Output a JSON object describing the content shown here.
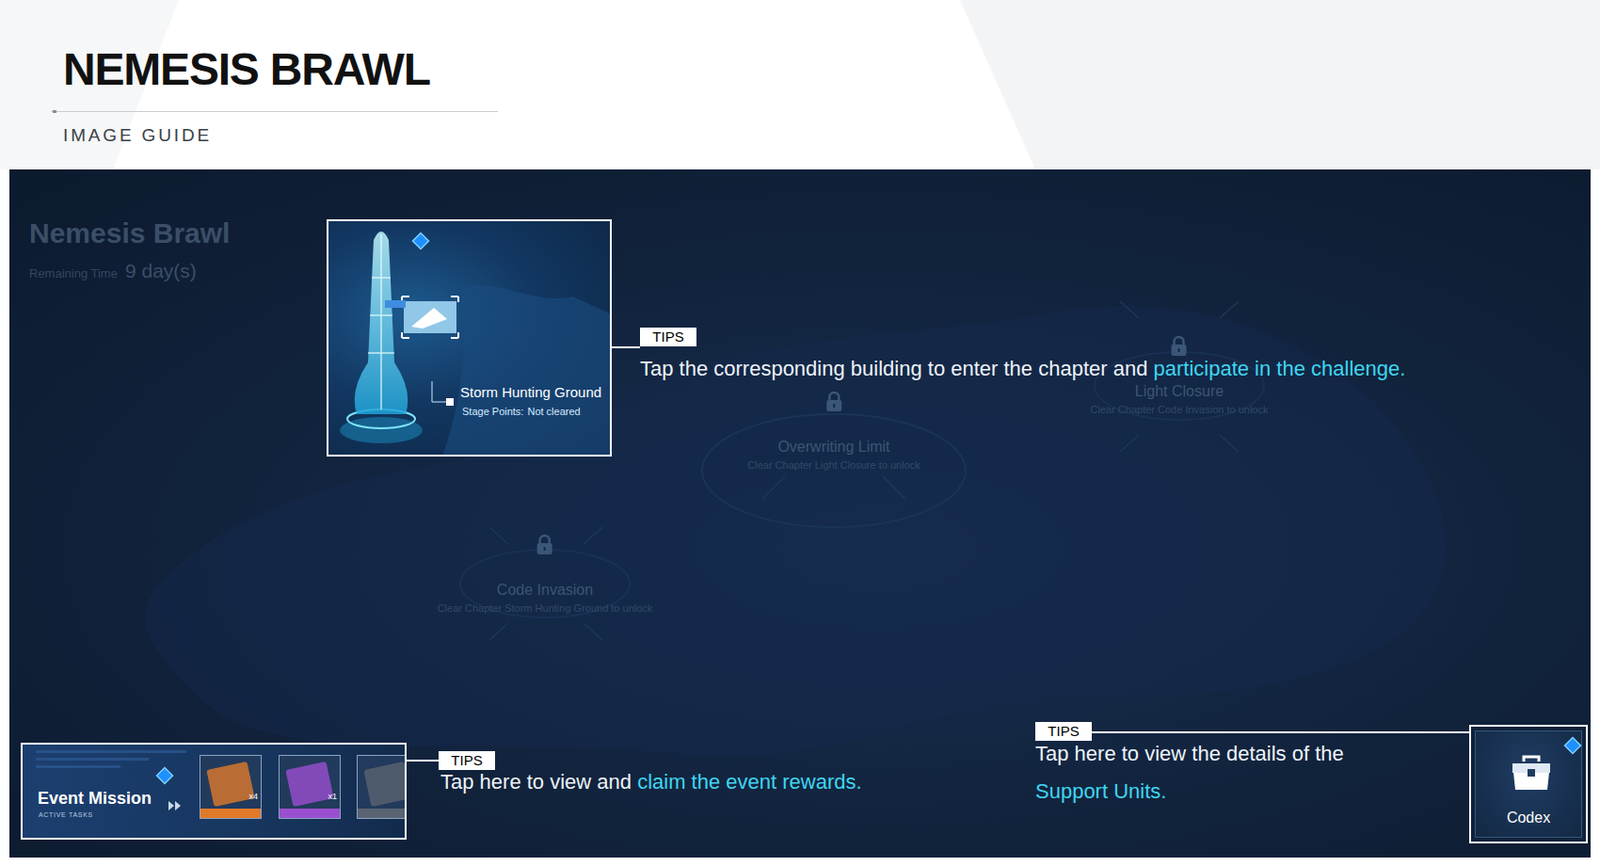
{
  "header": {
    "title": "NEMESIS BRAWL",
    "subtitle": "IMAGE GUIDE"
  },
  "event": {
    "title": "Nemesis Brawl",
    "remaining_label": "Remaining Time",
    "remaining_value": "9 day(s)"
  },
  "chapters": [
    {
      "kind": "open",
      "name": "Storm Hunting Ground",
      "points_label": "Stage Points:",
      "points_value": "Not cleared",
      "locked": false
    },
    {
      "kind": "locked",
      "name": "Code Invasion",
      "unlock_hint": "Clear Chapter Storm Hunting Ground to unlock",
      "locked": true
    },
    {
      "kind": "locked",
      "name": "Overwriting Limit",
      "unlock_hint": "Clear Chapter Light Closure to unlock",
      "locked": true
    },
    {
      "kind": "locked",
      "name": "Light Closure",
      "unlock_hint": "Clear Chapter Code Invasion to unlock",
      "locked": true
    }
  ],
  "tips": [
    {
      "label": "TIPS",
      "text": "Tap the corresponding building to enter the chapter and ",
      "highlight": "participate in the challenge."
    },
    {
      "label": "TIPS",
      "text": "Tap here to view and ",
      "highlight": "claim the event rewards."
    },
    {
      "label": "TIPS",
      "text": "Tap here to view the details of the ",
      "highlight": "Support Units."
    }
  ],
  "event_mission": {
    "title": "Event Mission",
    "subtitle": "ACTIVE TASKS",
    "rewards": [
      {
        "count": "x4",
        "color": "#e07a2a"
      },
      {
        "count": "x1",
        "color": "#9a4fd0"
      },
      {
        "color": "#5a6472"
      }
    ]
  },
  "codex": {
    "label": "Codex"
  }
}
